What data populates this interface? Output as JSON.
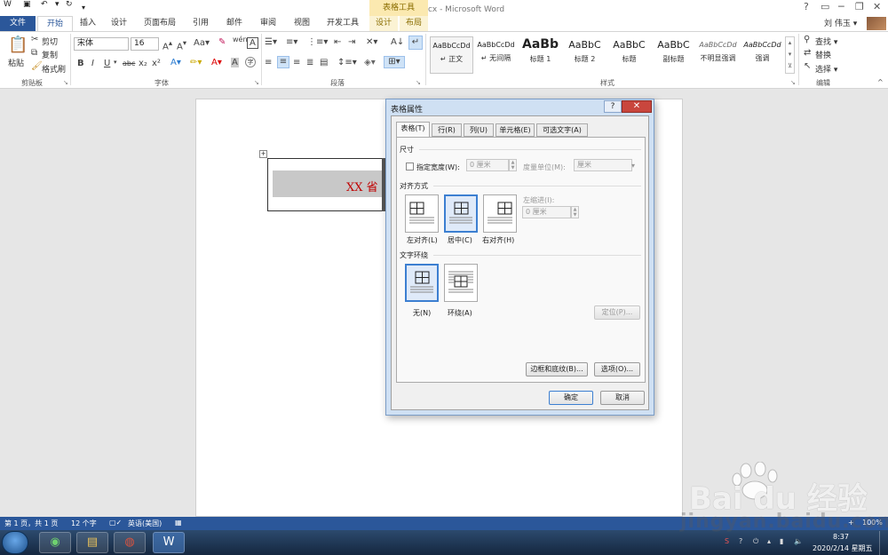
{
  "window": {
    "title": "公文制作.docx - Microsoft Word",
    "contextual_tab_group": "表格工具",
    "controls": [
      "?",
      "▭",
      "─",
      "❐",
      "✕"
    ]
  },
  "quick_access": [
    "save-icon",
    "undo-icon",
    "redo-icon",
    "customize-icon"
  ],
  "tabs": [
    {
      "label": "文件"
    },
    {
      "label": "开始"
    },
    {
      "label": "插入"
    },
    {
      "label": "设计"
    },
    {
      "label": "页面布局"
    },
    {
      "label": "引用"
    },
    {
      "label": "邮件"
    },
    {
      "label": "审阅"
    },
    {
      "label": "视图"
    },
    {
      "label": "开发工具"
    },
    {
      "label": "设计"
    },
    {
      "label": "布局"
    }
  ],
  "user": {
    "name": "刘 伟玉 ▾"
  },
  "ribbon": {
    "clipboard": {
      "group": "剪贴板",
      "paste": "粘贴",
      "cut": "剪切",
      "copy": "复制",
      "format_painter": "格式刷"
    },
    "font": {
      "group": "字体",
      "font_name": "宋体",
      "font_size": "16",
      "buttons": [
        "B",
        "I",
        "U",
        "abc",
        "x₂",
        "x²"
      ]
    },
    "paragraph": {
      "group": "段落"
    },
    "styles": {
      "group": "样式",
      "items": [
        {
          "sample": "AaBbCcDd",
          "label": "↵ 正文"
        },
        {
          "sample": "AaBbCcDd",
          "label": "↵ 无间隔"
        },
        {
          "sample": "AaBb",
          "label": "标题 1"
        },
        {
          "sample": "AaBbC",
          "label": "标题 2"
        },
        {
          "sample": "AaBbC",
          "label": "标题"
        },
        {
          "sample": "AaBbC",
          "label": "副标题"
        },
        {
          "sample": "AaBbCcDd",
          "label": "不明显强调"
        },
        {
          "sample": "AaBbCcDd",
          "label": "强调"
        }
      ]
    },
    "editing": {
      "group": "编辑",
      "find": "查找 ▾",
      "replace": "替换",
      "select": "选择 ▾"
    }
  },
  "document": {
    "cell_text": "XX 省"
  },
  "dialog": {
    "title": "表格属性",
    "help": "?",
    "close": "✕",
    "tabs": [
      {
        "label": "表格(T)"
      },
      {
        "label": "行(R)"
      },
      {
        "label": "列(U)"
      },
      {
        "label": "单元格(E)"
      },
      {
        "label": "可选文字(A)"
      }
    ],
    "size": {
      "section": "尺寸",
      "specify_width": "指定宽度(W):",
      "width_value": "0 厘米",
      "unit_label": "度量单位(M):",
      "unit_value": "厘米"
    },
    "alignment": {
      "section": "对齐方式",
      "left": "左对齐(L)",
      "center": "居中(C)",
      "right": "右对齐(H)",
      "indent_label": "左缩进(I):",
      "indent_value": "0 厘米"
    },
    "wrapping": {
      "section": "文字环绕",
      "none": "无(N)",
      "around": "环绕(A)",
      "positioning": "定位(P)..."
    },
    "borders_button": "边框和底纹(B)...",
    "options_button": "选项(O)...",
    "ok": "确定",
    "cancel": "取消"
  },
  "status": {
    "page": "第 1 页，共 1 页",
    "words": "12 个字",
    "language": "英语(美国)",
    "zoom": "100%"
  },
  "taskbar": {
    "time": "8:37",
    "date": "2020/2/14 星期五"
  },
  "watermark": {
    "logo": "Bai du 经验",
    "url": "jingyan.baidu.com"
  }
}
